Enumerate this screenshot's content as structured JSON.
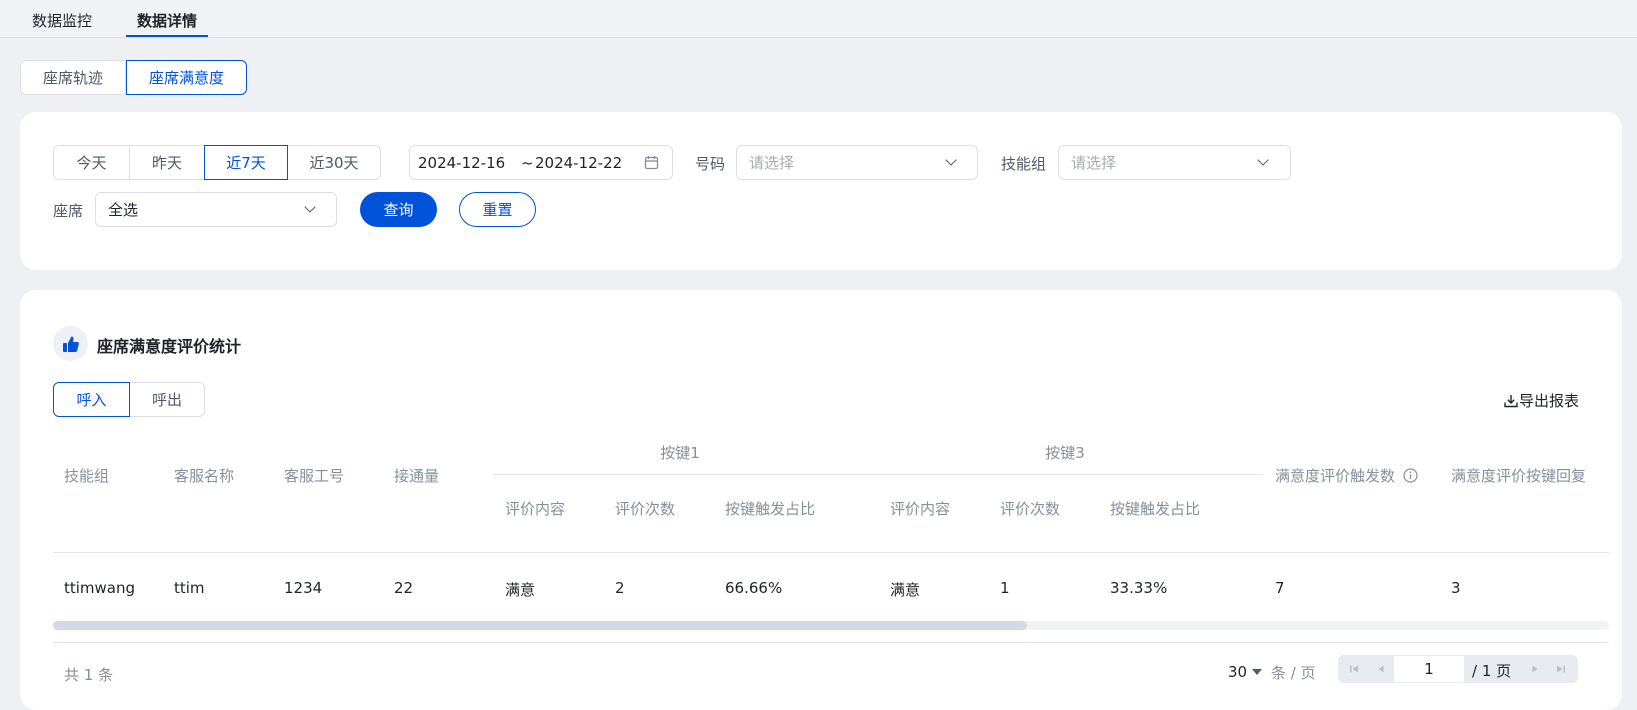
{
  "top_tabs": [
    "数据监控",
    "数据详情"
  ],
  "sub_tabs": [
    "座席轨迹",
    "座席满意度"
  ],
  "filters": {
    "date_presets": [
      "今天",
      "昨天",
      "近7天",
      "近30天"
    ],
    "date_start": "2024-12-16",
    "date_sep": "~",
    "date_end": "2024-12-22",
    "number_label": "号码",
    "number_placeholder": "请选择",
    "skill_label": "技能组",
    "skill_placeholder": "请选择",
    "agent_label": "座席",
    "agent_value": "全选",
    "query_button": "查询",
    "reset_button": "重置"
  },
  "stats": {
    "title": "座席满意度评价统计",
    "direction_tabs": [
      "呼入",
      "呼出"
    ],
    "export_label": "导出报表",
    "group_headers": [
      "按键1",
      "按键3"
    ],
    "columns": [
      "技能组",
      "客服名称",
      "客服工号",
      "接通量",
      "评价内容",
      "评价次数",
      "按键触发占比",
      "评价内容",
      "评价次数",
      "按键触发占比",
      "满意度评价触发数",
      "满意度评价按键回复"
    ],
    "rows": [
      [
        "ttimwang",
        "ttim",
        "1234",
        "22",
        "满意",
        "2",
        "66.66%",
        "满意",
        "1",
        "33.33%",
        "7",
        "3"
      ]
    ],
    "total_text": "共 1 条",
    "page_size": "30",
    "page_size_unit": "条 / 页",
    "page_current": "1",
    "page_total": "/ 1 页"
  }
}
